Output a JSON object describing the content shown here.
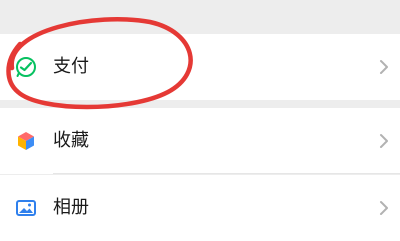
{
  "menu": {
    "items": [
      {
        "label": "支付",
        "icon": "wechat-pay-icon"
      },
      {
        "label": "收藏",
        "icon": "favorites-cube-icon"
      },
      {
        "label": "相册",
        "icon": "album-image-icon"
      }
    ],
    "chevron_icon": "chevron-right-icon"
  },
  "colors": {
    "background": "#ededed",
    "row": "#ffffff",
    "pay_green": "#07c160",
    "highlight_red": "#e53935"
  }
}
